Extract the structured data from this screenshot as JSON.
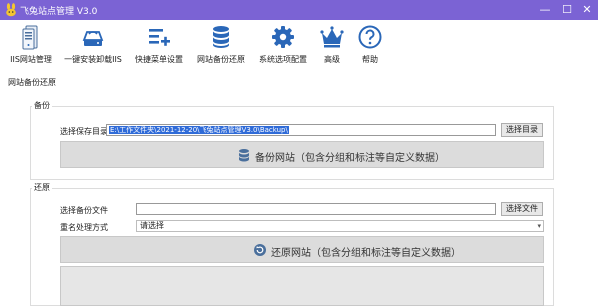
{
  "window": {
    "title": "飞兔站点管理 V3.0",
    "minimize_glyph": "—",
    "maximize_glyph": "☐",
    "close_glyph": "✕",
    "titlebar_color": "#7b63d4"
  },
  "toolbar": {
    "items": [
      {
        "label": "IIS网站管理",
        "icon": "server-icon"
      },
      {
        "label": "一键安装卸载IIS",
        "icon": "disk-drive-icon"
      },
      {
        "label": "快捷菜单设置",
        "icon": "menu-add-icon"
      },
      {
        "label": "网站备份还原",
        "icon": "database-icon"
      },
      {
        "label": "系统选项配置",
        "icon": "gear-icon"
      },
      {
        "label": "高级",
        "icon": "crown-icon"
      },
      {
        "label": "帮助",
        "icon": "help-icon"
      }
    ],
    "icon_color": "#2a67b8"
  },
  "main": {
    "section_label": "网站备份还原",
    "backup": {
      "group_title": "备份",
      "dir_label": "选择保存目录",
      "dir_value": "E:\\工作文件夹\\2021-12-20\\飞兔站点管理V3.0\\Backup\\",
      "select_dir_button": "选择目录",
      "backup_button": "备份网站（包含分组和标注等自定义数据）"
    },
    "restore": {
      "group_title": "还原",
      "file_label": "选择备份文件",
      "file_value": "",
      "select_file_button": "选择文件",
      "rename_label": "重名处理方式",
      "rename_value": "请选择",
      "restore_button": "还原网站（包含分组和标注等自定义数据）"
    }
  }
}
